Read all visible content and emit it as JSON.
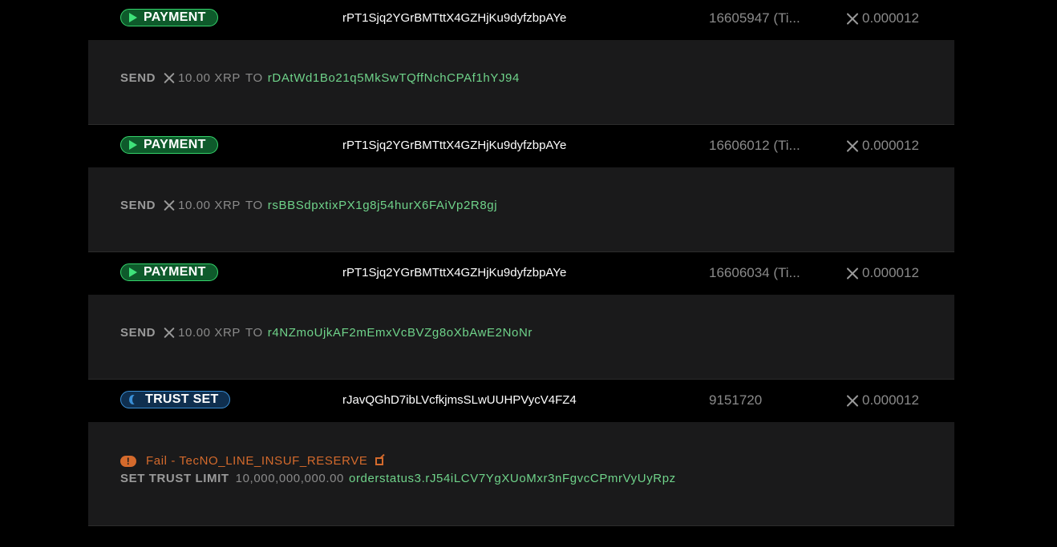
{
  "transactions": [
    {
      "type": "PAYMENT",
      "account": "rPT1Sjq2YGrBMTttX4GZHjKu9dyfzbpAYe",
      "ledger": "16605947 (Ti...",
      "fee": "0.000012",
      "detail": {
        "verb": "SEND",
        "amount": "10.00 XRP",
        "to": "TO",
        "destination": "rDAtWd1Bo21q5MkSwTQffNchCPAf1hYJ94"
      }
    },
    {
      "type": "PAYMENT",
      "account": "rPT1Sjq2YGrBMTttX4GZHjKu9dyfzbpAYe",
      "ledger": "16606012 (Ti...",
      "fee": "0.000012",
      "detail": {
        "verb": "SEND",
        "amount": "10.00 XRP",
        "to": "TO",
        "destination": "rsBBSdpxtixPX1g8j54hurX6FAiVp2R8gj"
      }
    },
    {
      "type": "PAYMENT",
      "account": "rPT1Sjq2YGrBMTttX4GZHjKu9dyfzbpAYe",
      "ledger": "16606034 (Ti...",
      "fee": "0.000012",
      "detail": {
        "verb": "SEND",
        "amount": "10.00 XRP",
        "to": "TO",
        "destination": "r4NZmoUjkAF2mEmxVcBVZg8oXbAwE2NoNr"
      }
    },
    {
      "type": "TRUST SET",
      "account": "rJavQGhD7ibLVcfkjmsSLwUUHPVycV4FZ4",
      "ledger": "9151720",
      "fee": "0.000012",
      "detail": {
        "status": "Fail - TecNO_LINE_INSUF_RESERVE",
        "verb": "SET TRUST LIMIT",
        "limit": "10,000,000,000.00",
        "issuer": "orderstatus3.rJ54iLCV7YgXUoMxr3nFgvcCPmrVyUyRpz"
      }
    }
  ],
  "colors": {
    "background": "#000000",
    "detail_bg": "#1a1a1b",
    "payment_badge_bg": "#0e5a2b",
    "payment_badge_border": "#34d46b",
    "trust_badge_bg": "#0f2f4f",
    "trust_badge_border": "#3a8fd6",
    "address_green": "#6fd38a",
    "fail_orange": "#d46a2c",
    "muted_text": "#8a8a8a"
  },
  "icons": {
    "payment": "play-icon",
    "trust_set": "half-moon-icon",
    "xrp": "xrp-icon",
    "fail": "alert-icon",
    "external": "external-link-icon"
  }
}
